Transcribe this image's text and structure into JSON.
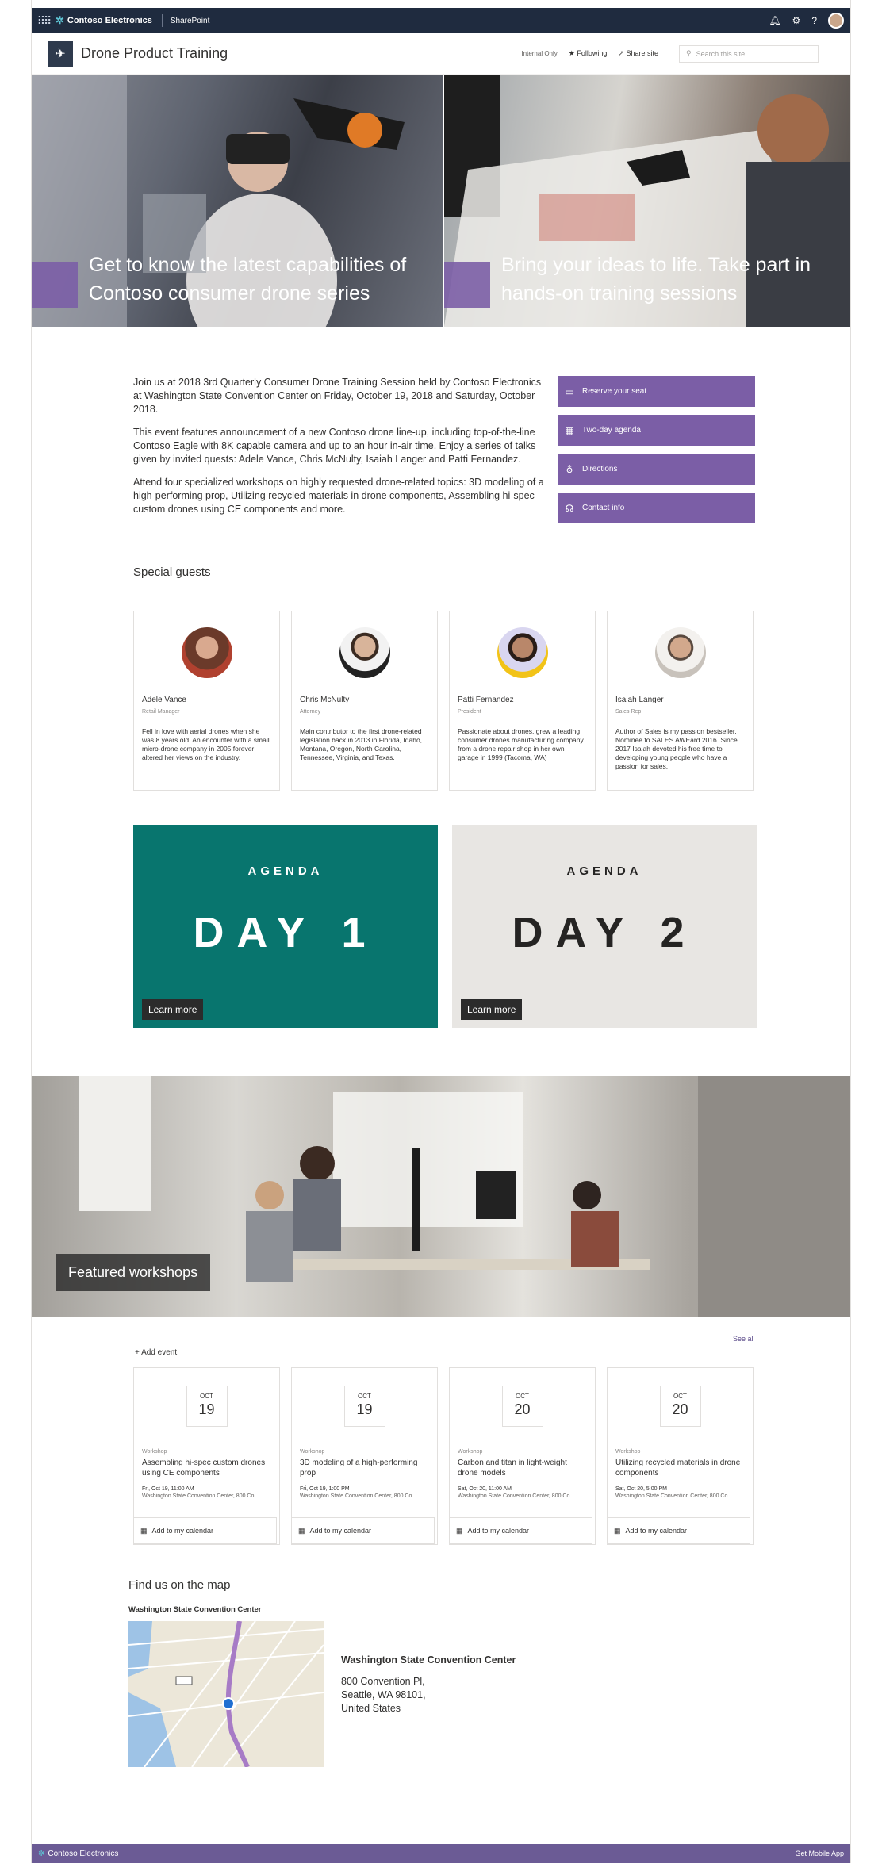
{
  "suite_bar": {
    "brand": "Contoso Electronics",
    "app": "SharePoint"
  },
  "site": {
    "title": "Drone Product Training",
    "classification": "Internal Only",
    "following": "Following",
    "share": "Share site",
    "search_placeholder": "Search this site"
  },
  "hero": [
    {
      "caption": "Get to know the latest capabilities of Contoso consumer drone series"
    },
    {
      "caption": "Bring your ideas to life. Take part in hands-on training sessions"
    }
  ],
  "intro": [
    "Join us at 2018 3rd Quarterly Consumer Drone Training Session held by Contoso Electronics at Washington State Convention Center on Friday, October 19, 2018 and Saturday, October 2018.",
    "This event features announcement of a new Contoso drone line-up, including top-of-the-line Contoso Eagle with 8K capable camera and up to an hour in-air time. Enjoy a series of talks given by invited quests: Adele Vance, Chris McNulty, Isaiah Langer and Patti Fernandez.",
    "Attend four specialized workshops on highly requested drone-related topics: 3D modeling of a high-performing prop, Utilizing recycled materials in drone components, Assembling hi-spec custom drones using CE components and more."
  ],
  "quick_links": [
    {
      "label": "Reserve your seat",
      "icon": "ticket-icon"
    },
    {
      "label": "Two-day agenda",
      "icon": "calendar-icon"
    },
    {
      "label": "Directions",
      "icon": "directions-icon"
    },
    {
      "label": "Contact info",
      "icon": "headset-icon"
    }
  ],
  "guests_heading": "Special guests",
  "guests": [
    {
      "name": "Adele Vance",
      "role": "Retail Manager",
      "desc": "Fell in love with aerial drones when she was 8 years old. An encounter with a small micro-drone company in 2005 forever altered her views on the industry."
    },
    {
      "name": "Chris McNulty",
      "role": "Attorney",
      "desc": "Main contributor to the first drone-related legislation back in 2013 in Florida, Idaho, Montana, Oregon, North Carolina, Tennessee, Virginia, and Texas."
    },
    {
      "name": "Patti Fernandez",
      "role": "President",
      "desc": "Passionate about drones, grew a leading consumer drones manufacturing company from a drone repair shop in her own garage in 1999 (Tacoma, WA)"
    },
    {
      "name": "Isaiah Langer",
      "role": "Sales Rep",
      "desc": "Author of Sales is my passion bestseller. Nominee to SALES AWEard 2016. Since 2017 Isaiah devoted his free time to developing young people who have a passion for sales."
    }
  ],
  "agenda": [
    {
      "label": "AGENDA",
      "day": "DAY 1",
      "button": "Learn more",
      "color": "#08756e"
    },
    {
      "label": "AGENDA",
      "day": "DAY 2",
      "button": "Learn more",
      "color": "#e8e6e3"
    }
  ],
  "workshops_banner": "Featured workshops",
  "events_actions": {
    "add": "Add event",
    "see_all": "See all"
  },
  "events": [
    {
      "month": "OCT",
      "day": "19",
      "type": "Workshop",
      "title": "Assembling hi-spec custom drones using CE components",
      "time": "Fri, Oct 19, 11:00 AM",
      "location": "Washington State Convention Center, 800 Co...",
      "cal": "Add to my calendar"
    },
    {
      "month": "OCT",
      "day": "19",
      "type": "Workshop",
      "title": "3D modeling of a high-performing prop",
      "time": "Fri, Oct 19, 1:00 PM",
      "location": "Washington State Convention Center, 800 Co...",
      "cal": "Add to my calendar"
    },
    {
      "month": "OCT",
      "day": "20",
      "type": "Workshop",
      "title": "Carbon and titan in light-weight drone models",
      "time": "Sat, Oct 20, 11:00 AM",
      "location": "Washington State Convention Center, 800 Co...",
      "cal": "Add to my calendar"
    },
    {
      "month": "OCT",
      "day": "20",
      "type": "Workshop",
      "title": "Utilizing recycled materials in drone components",
      "time": "Sat, Oct 20, 5:00 PM",
      "location": "Washington State Convention Center, 800 Co...",
      "cal": "Add to my calendar"
    }
  ],
  "map_section": {
    "heading": "Find us on the map",
    "map_title": "Washington State Convention Center",
    "name": "Washington State Convention Center",
    "address_lines": [
      "800 Convention Pl,",
      "Seattle, WA 98101,",
      "United States"
    ]
  },
  "footer": {
    "brand": "Contoso Electronics",
    "right": "Get Mobile App"
  },
  "colors": {
    "accent": "#7b5ea6",
    "suite": "#1f2b3f",
    "teal": "#08756e"
  }
}
